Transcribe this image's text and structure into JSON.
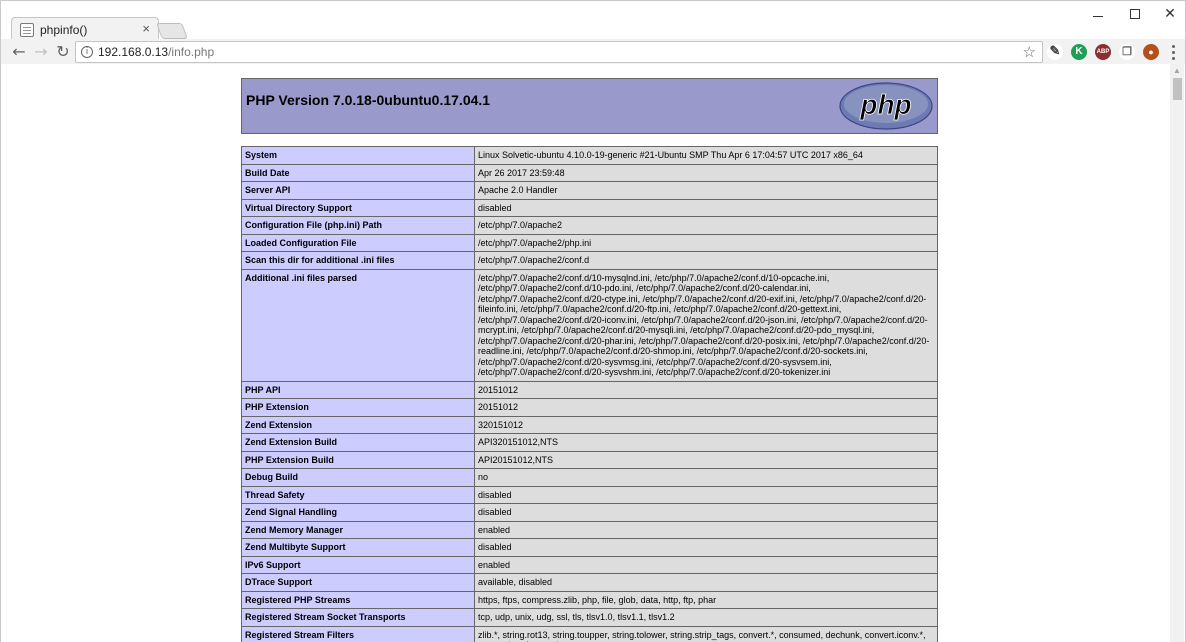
{
  "browser": {
    "tab_title": "phpinfo()",
    "tab_close": "×",
    "url_host": "192.168.0.13",
    "url_path": "/info.php",
    "extensions": [
      "K",
      "ABP"
    ]
  },
  "phpinfo": {
    "version_title": "PHP Version 7.0.18-0ubuntu0.17.04.1",
    "logo_text": "php",
    "rows": [
      {
        "key": "System",
        "value": "Linux Solvetic-ubuntu 4.10.0-19-generic #21-Ubuntu SMP Thu Apr 6 17:04:57 UTC 2017 x86_64"
      },
      {
        "key": "Build Date",
        "value": "Apr 26 2017 23:59:48"
      },
      {
        "key": "Server API",
        "value": "Apache 2.0 Handler"
      },
      {
        "key": "Virtual Directory Support",
        "value": "disabled"
      },
      {
        "key": "Configuration File (php.ini) Path",
        "value": "/etc/php/7.0/apache2"
      },
      {
        "key": "Loaded Configuration File",
        "value": "/etc/php/7.0/apache2/php.ini"
      },
      {
        "key": "Scan this dir for additional .ini files",
        "value": "/etc/php/7.0/apache2/conf.d"
      },
      {
        "key": "Additional .ini files parsed",
        "value": "/etc/php/7.0/apache2/conf.d/10-mysqlnd.ini, /etc/php/7.0/apache2/conf.d/10-opcache.ini, /etc/php/7.0/apache2/conf.d/10-pdo.ini, /etc/php/7.0/apache2/conf.d/20-calendar.ini, /etc/php/7.0/apache2/conf.d/20-ctype.ini, /etc/php/7.0/apache2/conf.d/20-exif.ini, /etc/php/7.0/apache2/conf.d/20-fileinfo.ini, /etc/php/7.0/apache2/conf.d/20-ftp.ini, /etc/php/7.0/apache2/conf.d/20-gettext.ini, /etc/php/7.0/apache2/conf.d/20-iconv.ini, /etc/php/7.0/apache2/conf.d/20-json.ini, /etc/php/7.0/apache2/conf.d/20-mcrypt.ini, /etc/php/7.0/apache2/conf.d/20-mysqli.ini, /etc/php/7.0/apache2/conf.d/20-pdo_mysql.ini, /etc/php/7.0/apache2/conf.d/20-phar.ini, /etc/php/7.0/apache2/conf.d/20-posix.ini, /etc/php/7.0/apache2/conf.d/20-readline.ini, /etc/php/7.0/apache2/conf.d/20-shmop.ini, /etc/php/7.0/apache2/conf.d/20-sockets.ini, /etc/php/7.0/apache2/conf.d/20-sysvmsg.ini, /etc/php/7.0/apache2/conf.d/20-sysvsem.ini, /etc/php/7.0/apache2/conf.d/20-sysvshm.ini, /etc/php/7.0/apache2/conf.d/20-tokenizer.ini"
      },
      {
        "key": "PHP API",
        "value": "20151012"
      },
      {
        "key": "PHP Extension",
        "value": "20151012"
      },
      {
        "key": "Zend Extension",
        "value": "320151012"
      },
      {
        "key": "Zend Extension Build",
        "value": "API320151012,NTS"
      },
      {
        "key": "PHP Extension Build",
        "value": "API20151012,NTS"
      },
      {
        "key": "Debug Build",
        "value": "no"
      },
      {
        "key": "Thread Safety",
        "value": "disabled"
      },
      {
        "key": "Zend Signal Handling",
        "value": "disabled"
      },
      {
        "key": "Zend Memory Manager",
        "value": "enabled"
      },
      {
        "key": "Zend Multibyte Support",
        "value": "disabled"
      },
      {
        "key": "IPv6 Support",
        "value": "enabled"
      },
      {
        "key": "DTrace Support",
        "value": "available, disabled"
      },
      {
        "key": "Registered PHP Streams",
        "value": "https, ftps, compress.zlib, php, file, glob, data, http, ftp, phar"
      },
      {
        "key": "Registered Stream Socket Transports",
        "value": "tcp, udp, unix, udg, ssl, tls, tlsv1.0, tlsv1.1, tlsv1.2"
      },
      {
        "key": "Registered Stream Filters",
        "value": "zlib.*, string.rot13, string.toupper, string.tolower, string.strip_tags, convert.*, consumed, dechunk, convert.iconv.*, mcrypt.*, mdecrypt.*"
      }
    ]
  },
  "colors": {
    "header_bg": "#9999cc",
    "key_cell_bg": "#ccccff",
    "value_cell_bg": "#dddddd",
    "border": "#666666"
  }
}
